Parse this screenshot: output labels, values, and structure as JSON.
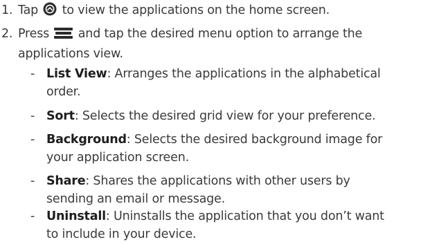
{
  "steps": [
    {
      "number": "1.",
      "before_icon": "Tap ",
      "icon": "apps-circle-icon",
      "after_icon": " to view the applications on the home screen."
    },
    {
      "number": "2.",
      "before_icon": "Press ",
      "icon": "menu-key-icon",
      "after_icon": " and tap the desired menu option to arrange the",
      "line2": "applications view."
    }
  ],
  "options": [
    {
      "dash": "-",
      "term": "List View",
      "desc": ": Arranges the applications in the alphabetical",
      "desc2": "order."
    },
    {
      "dash": "-",
      "term": "Sort",
      "desc": ": Selects the desired grid view for your preference.",
      "desc2": ""
    },
    {
      "dash": "-",
      "term": "Background",
      "desc": ": Selects the desired background image for",
      "desc2": "your application screen."
    },
    {
      "dash": "-",
      "term": "Share",
      "desc": ": Shares the applications with other users by",
      "desc2": "sending an email or message."
    },
    {
      "dash": "-",
      "term": "Uninstall",
      "desc": ": Uninstalls the application that you don’t want",
      "desc2": "to include in your device."
    }
  ],
  "colors": {
    "text": "#3a3a3a",
    "term": "#1e1e1e",
    "icon": "#2b2b2b"
  }
}
